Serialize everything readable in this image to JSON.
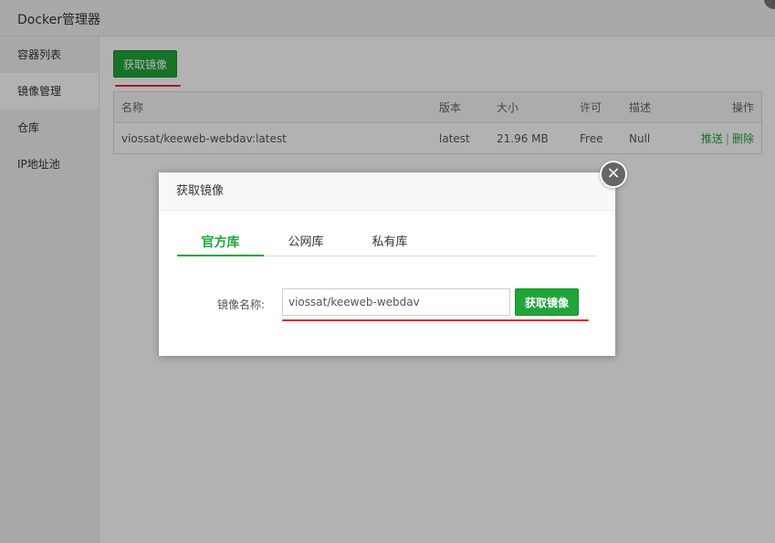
{
  "window": {
    "title": "Docker管理器"
  },
  "sidebar": {
    "items": [
      {
        "label": "容器列表"
      },
      {
        "label": "镜像管理"
      },
      {
        "label": "仓库"
      },
      {
        "label": "IP地址池"
      }
    ]
  },
  "toolbar": {
    "get_image_label": "获取镜像"
  },
  "table": {
    "headers": {
      "name": "名称",
      "version": "版本",
      "size": "大小",
      "license": "许可",
      "description": "描述",
      "actions": "操作"
    },
    "rows": [
      {
        "name": "viossat/keeweb-webdav:latest",
        "version": "latest",
        "size": "21.96 MB",
        "license": "Free",
        "description": "Null",
        "push": "推送",
        "separator": "|",
        "delete": "删除"
      }
    ]
  },
  "modal": {
    "title": "获取镜像",
    "close_glyph": "×",
    "tabs": [
      {
        "label": "官方库"
      },
      {
        "label": "公网库"
      },
      {
        "label": "私有库"
      }
    ],
    "form": {
      "label": "镜像名称:",
      "value": "viossat/keeweb-webdav",
      "button_label": "获取镜像"
    }
  },
  "colors": {
    "accent": "#20a53a",
    "annotation": "#e8262b"
  }
}
